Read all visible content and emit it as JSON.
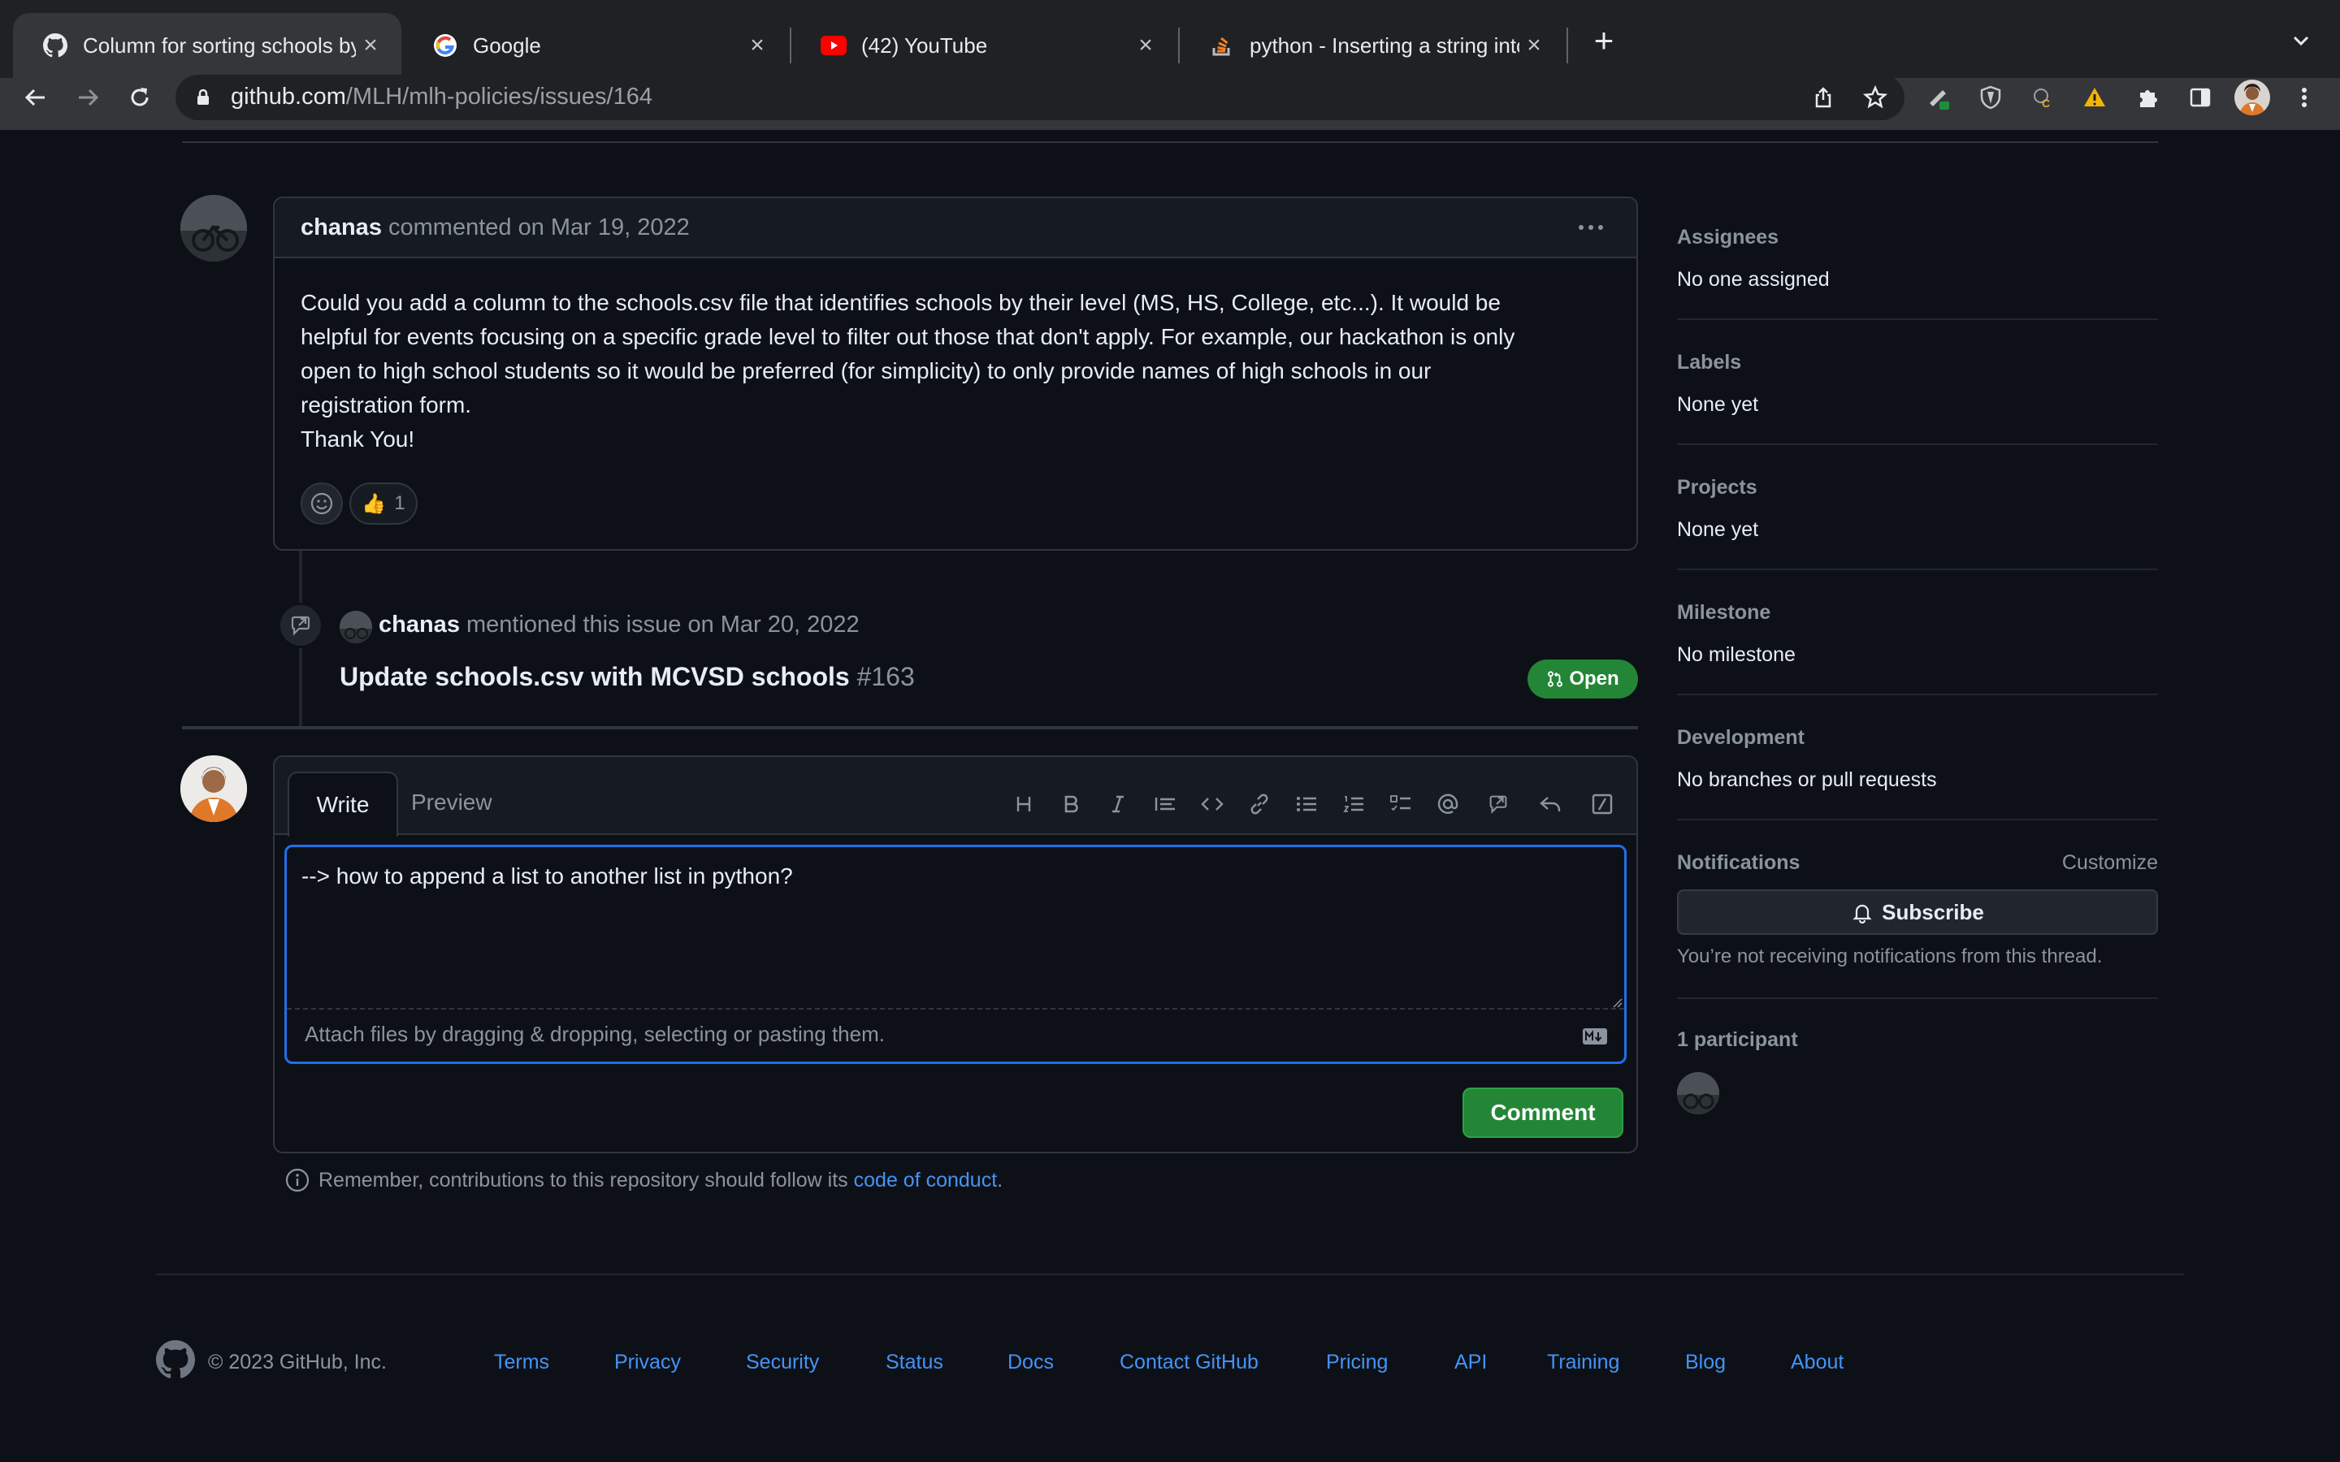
{
  "browser": {
    "tabs": [
      {
        "title": "Column for sorting schools by",
        "icon": "github-icon"
      },
      {
        "title": "Google",
        "icon": "google-icon"
      },
      {
        "title": "(42) YouTube",
        "icon": "youtube-icon"
      },
      {
        "title": "python - Inserting a string into",
        "icon": "stackoverflow-icon"
      }
    ],
    "url_domain": "github.com",
    "url_path": "/MLH/mlh-policies/issues/164"
  },
  "comment": {
    "author": "chanas",
    "meta": "commented on Mar 19, 2022",
    "body_lines": [
      "Could you add a column to the schools.csv file that identifies schools by their level (MS, HS, College, etc...). It would be",
      "helpful for events focusing on a specific grade level to filter out those that don't apply. For example, our hackathon is only",
      "open to high school students so it would be preferred (for simplicity) to only provide names of high schools in our",
      "registration form.",
      "Thank You!"
    ],
    "reaction_emoji": "👍",
    "reaction_count": "1"
  },
  "mention": {
    "author": "chanas",
    "meta": "mentioned this issue on Mar 20, 2022",
    "pr_title": "Update schools.csv with MCVSD schools",
    "pr_number": "#163",
    "pr_state": "Open"
  },
  "editor": {
    "tab_write": "Write",
    "tab_preview": "Preview",
    "text": "--> how to append a list to another list in python?",
    "attach_hint": "Attach files by dragging & dropping, selecting or pasting them.",
    "submit_label": "Comment"
  },
  "conduct": {
    "text": "Remember, contributions to this repository should follow its",
    "link": "code of conduct",
    "end": "."
  },
  "sidebar": {
    "assignees_label": "Assignees",
    "assignees_value": "No one assigned",
    "labels_label": "Labels",
    "labels_value": "None yet",
    "projects_label": "Projects",
    "projects_value": "None yet",
    "milestone_label": "Milestone",
    "milestone_value": "No milestone",
    "development_label": "Development",
    "development_value": "No branches or pull requests",
    "notifications_label": "Notifications",
    "customize_label": "Customize",
    "subscribe_label": "Subscribe",
    "notifications_note": "You’re not receiving notifications from this thread.",
    "participants_label": "1 participant"
  },
  "footer": {
    "copyright": "© 2023 GitHub, Inc.",
    "links": [
      "Terms",
      "Privacy",
      "Security",
      "Status",
      "Docs",
      "Contact GitHub",
      "Pricing",
      "API",
      "Training",
      "Blog",
      "About"
    ]
  },
  "colors": {
    "accent": "#4493f8",
    "success": "#238636",
    "bg": "#0d1117",
    "border": "#30363d"
  }
}
